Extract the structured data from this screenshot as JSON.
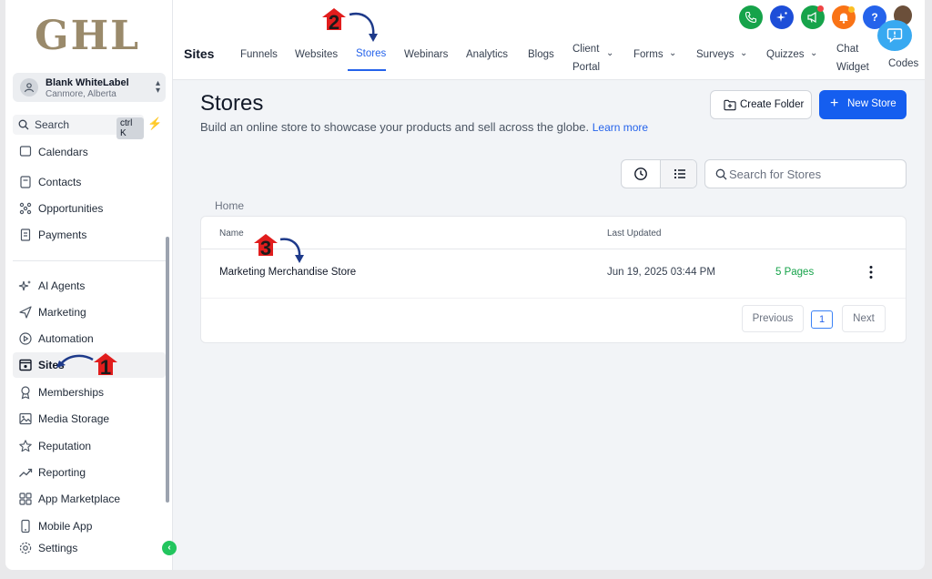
{
  "brand": {
    "logo_text": "GHL"
  },
  "account": {
    "name": "Blank WhiteLabel",
    "location": "Canmore, Alberta"
  },
  "sidebar_search": {
    "label": "Search",
    "shortcut": "ctrl K"
  },
  "sidebar": {
    "items": [
      {
        "label": "Calendars",
        "icon": "calendar-icon"
      },
      {
        "label": "Contacts",
        "icon": "contacts-icon"
      },
      {
        "label": "Opportunities",
        "icon": "opportunities-icon"
      },
      {
        "label": "Payments",
        "icon": "payments-icon"
      },
      {
        "label": "AI Agents",
        "icon": "ai-agents-icon"
      },
      {
        "label": "Marketing",
        "icon": "marketing-icon"
      },
      {
        "label": "Automation",
        "icon": "automation-icon"
      },
      {
        "label": "Sites",
        "icon": "sites-icon",
        "active": true
      },
      {
        "label": "Memberships",
        "icon": "memberships-icon"
      },
      {
        "label": "Media Storage",
        "icon": "media-storage-icon"
      },
      {
        "label": "Reputation",
        "icon": "reputation-icon"
      },
      {
        "label": "Reporting",
        "icon": "reporting-icon"
      },
      {
        "label": "App Marketplace",
        "icon": "app-marketplace-icon"
      },
      {
        "label": "Mobile App",
        "icon": "mobile-app-icon"
      },
      {
        "label": "Settings",
        "icon": "settings-icon"
      }
    ]
  },
  "header": {
    "section_title": "Sites",
    "tabs": [
      {
        "label": "Funnels"
      },
      {
        "label": "Websites"
      },
      {
        "label": "Stores",
        "active": true
      },
      {
        "label": "Webinars"
      },
      {
        "label": "Analytics"
      },
      {
        "label": "Blogs"
      },
      {
        "label_line1": "Client",
        "label_line2": "Portal"
      },
      {
        "label": "Forms"
      },
      {
        "label": "Surveys"
      },
      {
        "label": "Quizzes"
      },
      {
        "label_line1": "Chat",
        "label_line2": "Widget"
      },
      {
        "label": "Codes"
      }
    ],
    "icons": [
      "phone-icon",
      "magic-icon",
      "megaphone-icon",
      "bell-icon",
      "help-icon"
    ],
    "colors": {
      "phone": "#16a34a",
      "magic": "#1d4ed8",
      "megaphone": "#16a34a",
      "bell": "#f97316",
      "help": "#2563eb"
    }
  },
  "page": {
    "title": "Stores",
    "subtitle": "Build an online store to showcase your products and sell across the globe.",
    "learn_more": "Learn more",
    "create_folder": "Create Folder",
    "new_store": "New Store",
    "search_placeholder": "Search for Stores",
    "breadcrumb": "Home"
  },
  "table": {
    "columns": [
      "Name",
      "Last Updated"
    ],
    "rows": [
      {
        "name": "Marketing Merchandise Store",
        "last_updated": "Jun 19, 2025 03:44 PM",
        "pages": "5 Pages"
      }
    ],
    "pagination": {
      "previous": "Previous",
      "current": "1",
      "next": "Next"
    }
  },
  "annotations": {
    "marker_1": "1",
    "marker_2": "2",
    "marker_3": "3"
  },
  "colors": {
    "accent": "#155eef",
    "marker": "#e11d1d",
    "arrow": "#1e3a8a",
    "pages_text": "#16a34a"
  }
}
